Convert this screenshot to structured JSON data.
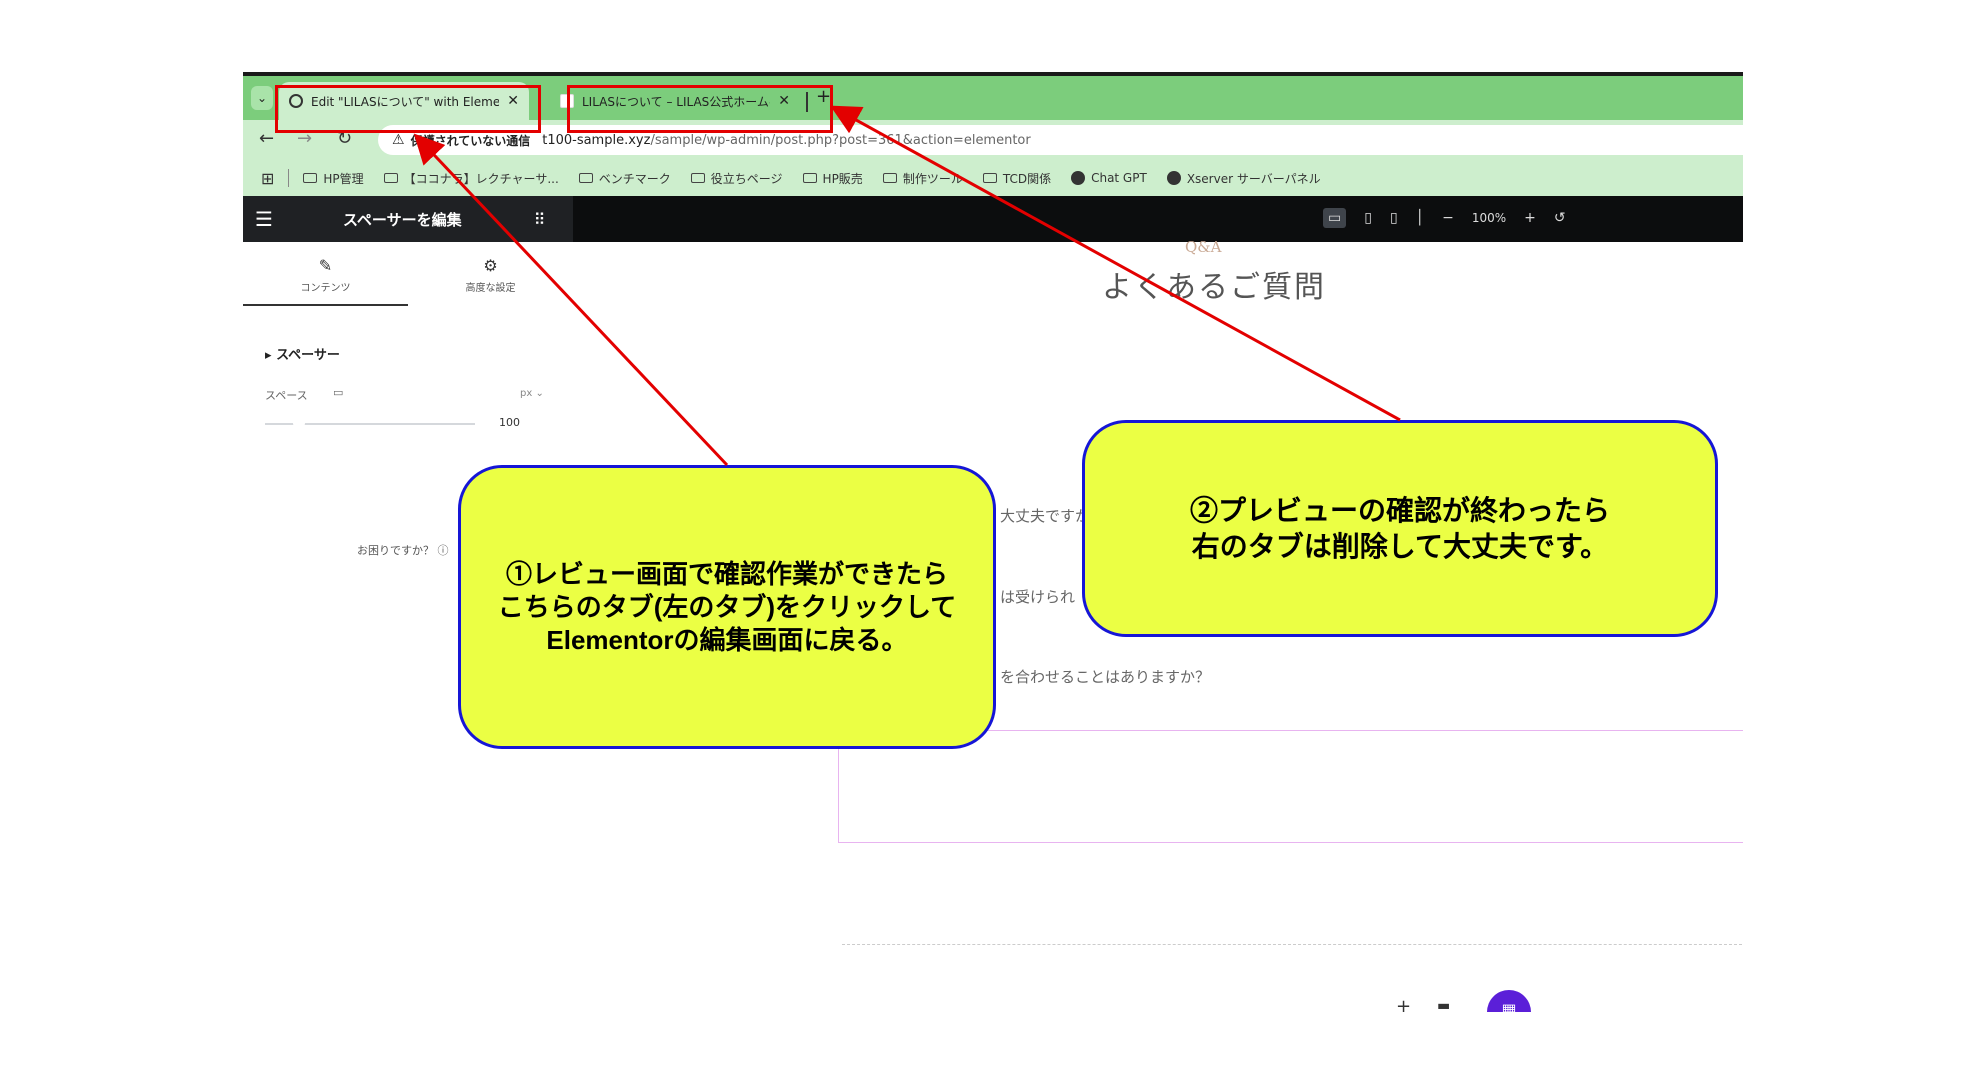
{
  "browser": {
    "tabs": [
      {
        "title": "Edit \"LILASについて\" with Elementor",
        "active": true
      },
      {
        "title": "LILASについて – LILAS公式ホームページ",
        "active": false
      }
    ],
    "tab_menu_icon": "chevron-down-icon",
    "new_tab_label": "+",
    "not_secure_label": "保護されていない通信",
    "url_host": "t100-sample.xyz",
    "url_path": "/sample/wp-admin/post.php?post=361&action=elementor",
    "bookmarks": [
      "HP管理",
      "【ココナラ】レクチャーサ...",
      "ベンチマーク",
      "役立ちページ",
      "HP販売",
      "制作ツール",
      "TCD関係",
      "Chat GPT",
      "Xserver サーバーパネル"
    ]
  },
  "elementor": {
    "panel_title": "スペーサーを編集",
    "tabs": [
      "コンテンツ",
      "高度な設定"
    ],
    "section_title": "スペーサー",
    "space_label": "スペース",
    "unit": "px",
    "space_value": "100",
    "help_text": "お困りですか？",
    "zoom": "100%"
  },
  "preview": {
    "qa_small": "Q&A",
    "title": "よくあるご質問",
    "faq_fragments": [
      "大丈夫ですか？",
      "は受けられ",
      "を合わせることはありますか？"
    ]
  },
  "annotations": {
    "callout1": [
      "①レビュー画面で確認作業ができたら",
      "こちらのタブ(左のタブ)をクリックして",
      "Elementorの編集画面に戻る。"
    ],
    "callout2": [
      "②プレビューの確認が終わったら",
      "右のタブは削除して大丈夫です。"
    ],
    "callout_fill": "#ebff44",
    "callout_border": "#1616d6",
    "arrow_color": "#e30000"
  }
}
